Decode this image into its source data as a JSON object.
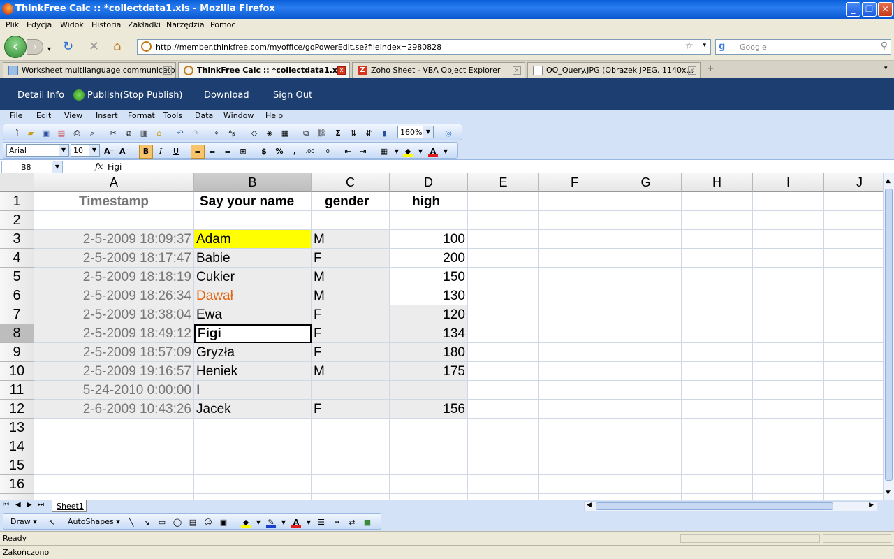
{
  "window": {
    "title": "ThinkFree Calc :: *collectdata1.xls - Mozilla Firefox"
  },
  "ff_menu": [
    "Plik",
    "Edycja",
    "Widok",
    "Historia",
    "Zakładki",
    "Narzędzia",
    "Pomoc"
  ],
  "nav": {
    "url": "http://member.thinkfree.com/myoffice/goPowerEdit.se?fileIndex=2980828",
    "search_placeholder": "Google"
  },
  "tabs": [
    {
      "label": "Worksheet multilanguage communicator"
    },
    {
      "label": "ThinkFree Calc :: *collectdata1.xls"
    },
    {
      "label": "Zoho Sheet - VBA Object Explorer"
    },
    {
      "label": "OO_Query.JPG (Obrazek JPEG, 1140x..."
    }
  ],
  "app_header": {
    "detail": "Detail Info",
    "publish": "Publish(Stop Publish)",
    "download": "Download",
    "signout": "Sign Out"
  },
  "calc_menu": [
    "File",
    "Edit",
    "View",
    "Insert",
    "Format",
    "Tools",
    "Data",
    "Window",
    "Help"
  ],
  "toolbar": {
    "zoom": "160%",
    "font": "Arial",
    "size": "10"
  },
  "formula": {
    "cellref": "B8",
    "fx": "fx",
    "content": "Figi"
  },
  "columns": [
    "A",
    "B",
    "C",
    "D",
    "E",
    "F",
    "G",
    "H",
    "I",
    "J"
  ],
  "rows": [
    "1",
    "2",
    "3",
    "4",
    "5",
    "6",
    "7",
    "8",
    "9",
    "10",
    "11",
    "12",
    "13",
    "14",
    "15",
    "16"
  ],
  "sheet": {
    "header": {
      "a": "Timestamp",
      "b": "Say your name",
      "c": "gender",
      "d": "high"
    },
    "data": [
      {
        "a": "2-5-2009 18:09:37",
        "b": "Adam",
        "c": "M",
        "d": "100"
      },
      {
        "a": "2-5-2009 18:17:47",
        "b": "Babie",
        "c": "F",
        "d": "200"
      },
      {
        "a": "2-5-2009 18:18:19",
        "b": "Cukier",
        "c": "M",
        "d": "150"
      },
      {
        "a": "2-5-2009 18:26:34",
        "b": "Dawał",
        "c": "M",
        "d": "130"
      },
      {
        "a": "2-5-2009 18:38:04",
        "b": "Ewa",
        "c": "F",
        "d": "120"
      },
      {
        "a": "2-5-2009 18:49:12",
        "b": "Figi",
        "c": "F",
        "d": "134"
      },
      {
        "a": "2-5-2009 18:57:09",
        "b": "Gryzła",
        "c": "F",
        "d": "180"
      },
      {
        "a": "2-5-2009 19:16:57",
        "b": "Heniek",
        "c": "M",
        "d": "175"
      },
      {
        "a": "5-24-2010 0:00:00",
        "b": "I",
        "c": "",
        "d": ""
      },
      {
        "a": "2-6-2009 10:43:26",
        "b": "Jacek",
        "c": "F",
        "d": "156"
      }
    ]
  },
  "sheet_tab": "Sheet1",
  "drawbar": {
    "draw": "Draw",
    "autoshapes": "AutoShapes"
  },
  "status": {
    "ready": "Ready",
    "ff": "Zakończono"
  },
  "colors": {
    "highlight": "#ffff00",
    "orange_text": "#e2640f",
    "header_navy": "#1d3e70"
  }
}
